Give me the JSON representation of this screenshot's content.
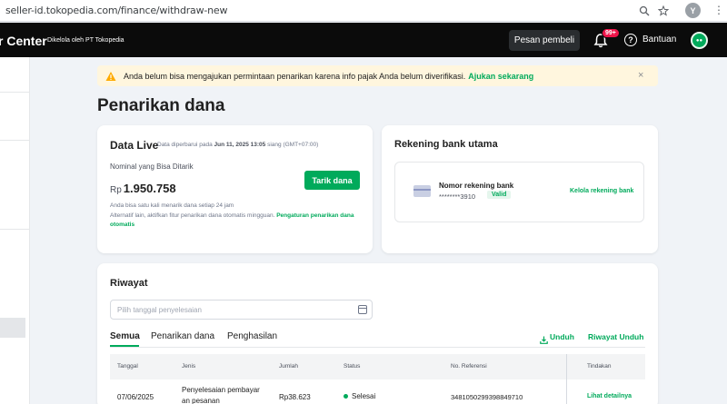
{
  "browser": {
    "url": "seller-id.tokopedia.com/finance/withdraw-new",
    "profile_initial": "Y"
  },
  "header": {
    "title": "r Center",
    "subtitle": "Dikelola oleh PT Tokopedia",
    "buyer_message_button": "Pesan pembeli",
    "notification_count": "99+",
    "help_label": "Bantuan"
  },
  "alert": {
    "message": "Anda belum bisa mengajukan permintaan penarikan karena info pajak Anda belum diverifikasi.",
    "link": "Ajukan sekarang",
    "close": "×"
  },
  "page_title": "Penarikan dana",
  "data_live": {
    "title": "Data Live",
    "updated_prefix": "Data diperbarui pada",
    "updated_time": "Jun 11, 2025 13:05",
    "updated_suffix": "siang (GMT+07:00)",
    "nominal_label": "Nominal yang Bisa Ditarik",
    "currency": "Rp",
    "amount": "1.950.758",
    "withdraw_button": "Tarik dana",
    "note1": "Anda bisa satu kali menarik dana setiap 24 jam",
    "note2": "Alternatif lain, aktifkan fitur penarikan dana otomatis mingguan.",
    "note2_link": "Pengaturan penarikan dana otomatis"
  },
  "bank": {
    "title": "Rekening bank utama",
    "account_label": "Nomor rekening bank",
    "account_number": "********3910",
    "status": "Valid",
    "manage_link": "Kelola rekening bank"
  },
  "history": {
    "title": "Riwayat",
    "date_placeholder": "Pilih tanggal penyelesaian",
    "tabs": [
      "Semua",
      "Penarikan dana",
      "Penghasilan"
    ],
    "download": "Unduh",
    "download_history": "Riwayat Unduh",
    "columns": [
      "Tanggal",
      "Jenis",
      "Jumlah",
      "Status",
      "No. Referensi",
      "Tindakan"
    ],
    "rows": [
      {
        "date": "07/06/2025",
        "type_line1": "Penyelesaian pembayar",
        "type_line2": "an pesanan",
        "amount": "Rp38.623",
        "status": "Selesai",
        "reference": "3481050299398849710",
        "action": "Lihat detailnya"
      }
    ]
  },
  "colors": {
    "accent": "#00aa5b",
    "header_bg": "#0b0b0b",
    "alert_bg": "#fff6de",
    "badge": "#ef144a"
  }
}
